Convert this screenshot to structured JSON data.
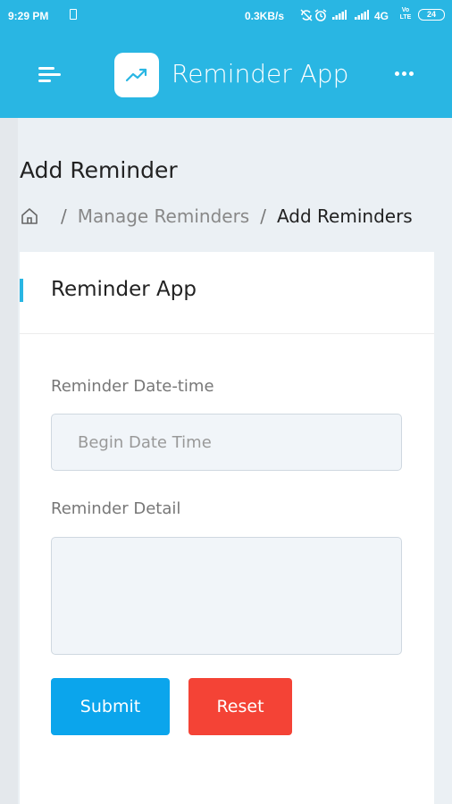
{
  "status_bar": {
    "time": "9:29 PM",
    "speed": "0.3KB/s",
    "network": "4G",
    "volte_top": "Vo",
    "volte_bottom": "LTE",
    "battery": "24"
  },
  "app_bar": {
    "title": "Reminder App",
    "color": "#29b6e3"
  },
  "page": {
    "title": "Add Reminder",
    "breadcrumb": {
      "sep": "/",
      "link": "Manage Reminders",
      "current": "Add Reminders"
    }
  },
  "card": {
    "title": "Reminder App",
    "datetime_label": "Reminder Date-time",
    "datetime_placeholder": "Begin Date Time",
    "detail_label": "Reminder Detail",
    "detail_value": ""
  },
  "buttons": {
    "submit": "Submit",
    "reset": "Reset",
    "submit_color": "#0ba5ec",
    "reset_color": "#f44336"
  },
  "icons": [
    "sim-icon",
    "sync-icon",
    "alarm-icon",
    "signal-icon",
    "menu-icon",
    "trend-up-icon",
    "more-icon",
    "home-icon"
  ]
}
